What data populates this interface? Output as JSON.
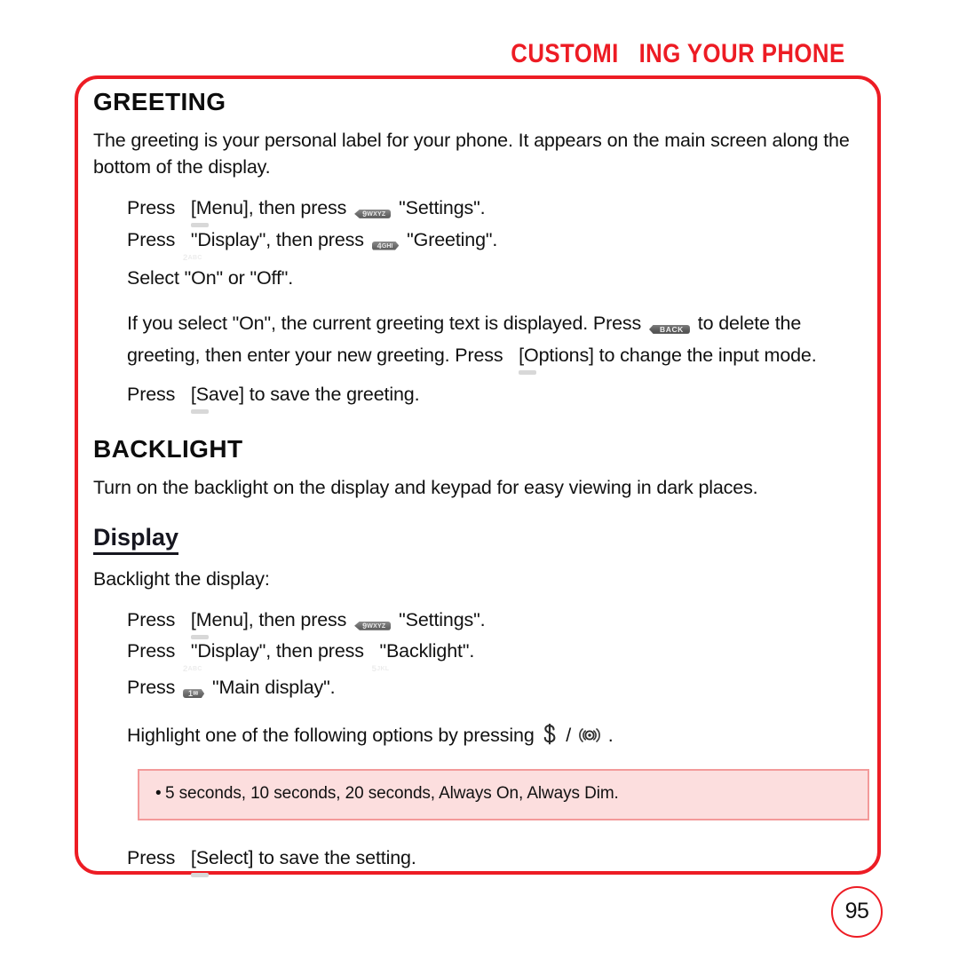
{
  "header": {
    "title": "CUSTOMI   ING YOUR PHONE",
    "accent_color": "#ED1C24"
  },
  "frame": {
    "border_color": "#ED1C24"
  },
  "sections": {
    "greeting": {
      "heading": "GREETING",
      "intro": "The greeting is your personal label for your phone.  It appears on the main screen along the bottom of the display.",
      "steps": {
        "step1_a": "Press",
        "step1_b": "[Menu], then press",
        "step1_c": "\"Settings\".",
        "step2_a": "Press",
        "step2_b": "\"Display\", then press",
        "step2_c": "\"Greeting\".",
        "step3": "Select \"On\" or \"Off\".",
        "step4_a": "If you select \"On\", the current greeting text is displayed.  Press",
        "step4_b": "to delete the greeting, then enter your new greeting.  Press",
        "step4_c": "[Options] to change the input mode.",
        "step5_a": "Press",
        "step5_b": "[Save] to save the greeting."
      }
    },
    "backlight": {
      "heading": "BACKLIGHT",
      "intro": "Turn on the backlight on the display and keypad for easy viewing in dark places.",
      "subheading": "Display",
      "lead_in": "Backlight the display:",
      "steps": {
        "step1_a": "Press",
        "step1_b": "[Menu], then press",
        "step1_c": "\"Settings\".",
        "step2_a": "Press",
        "step2_b": "\"Display\", then press",
        "step2_c": "\"Backlight\".",
        "step3_a": "Press",
        "step3_b": "\"Main display\".",
        "step4_a": "Highlight one of the following options by pressing",
        "step4_sep": "/",
        "step4_end": "."
      },
      "note": {
        "bullet": "•",
        "text": "5 seconds, 10 seconds, 20 seconds, Always On, Always Dim.",
        "bg_color": "#FCDEDE",
        "border_color": "#F39A9A"
      }
    }
  },
  "keys": {
    "softkey_label": "",
    "key9": "9",
    "key9_letters": "WXYZ",
    "key2": "2",
    "key2_letters": "ABC",
    "key4": "4",
    "key4_letters": "GHI",
    "key5": "5",
    "key5_letters": "JKL",
    "key1": "1",
    "key1_letters": "✉",
    "back_label": "BACK"
  },
  "page_number": "95"
}
